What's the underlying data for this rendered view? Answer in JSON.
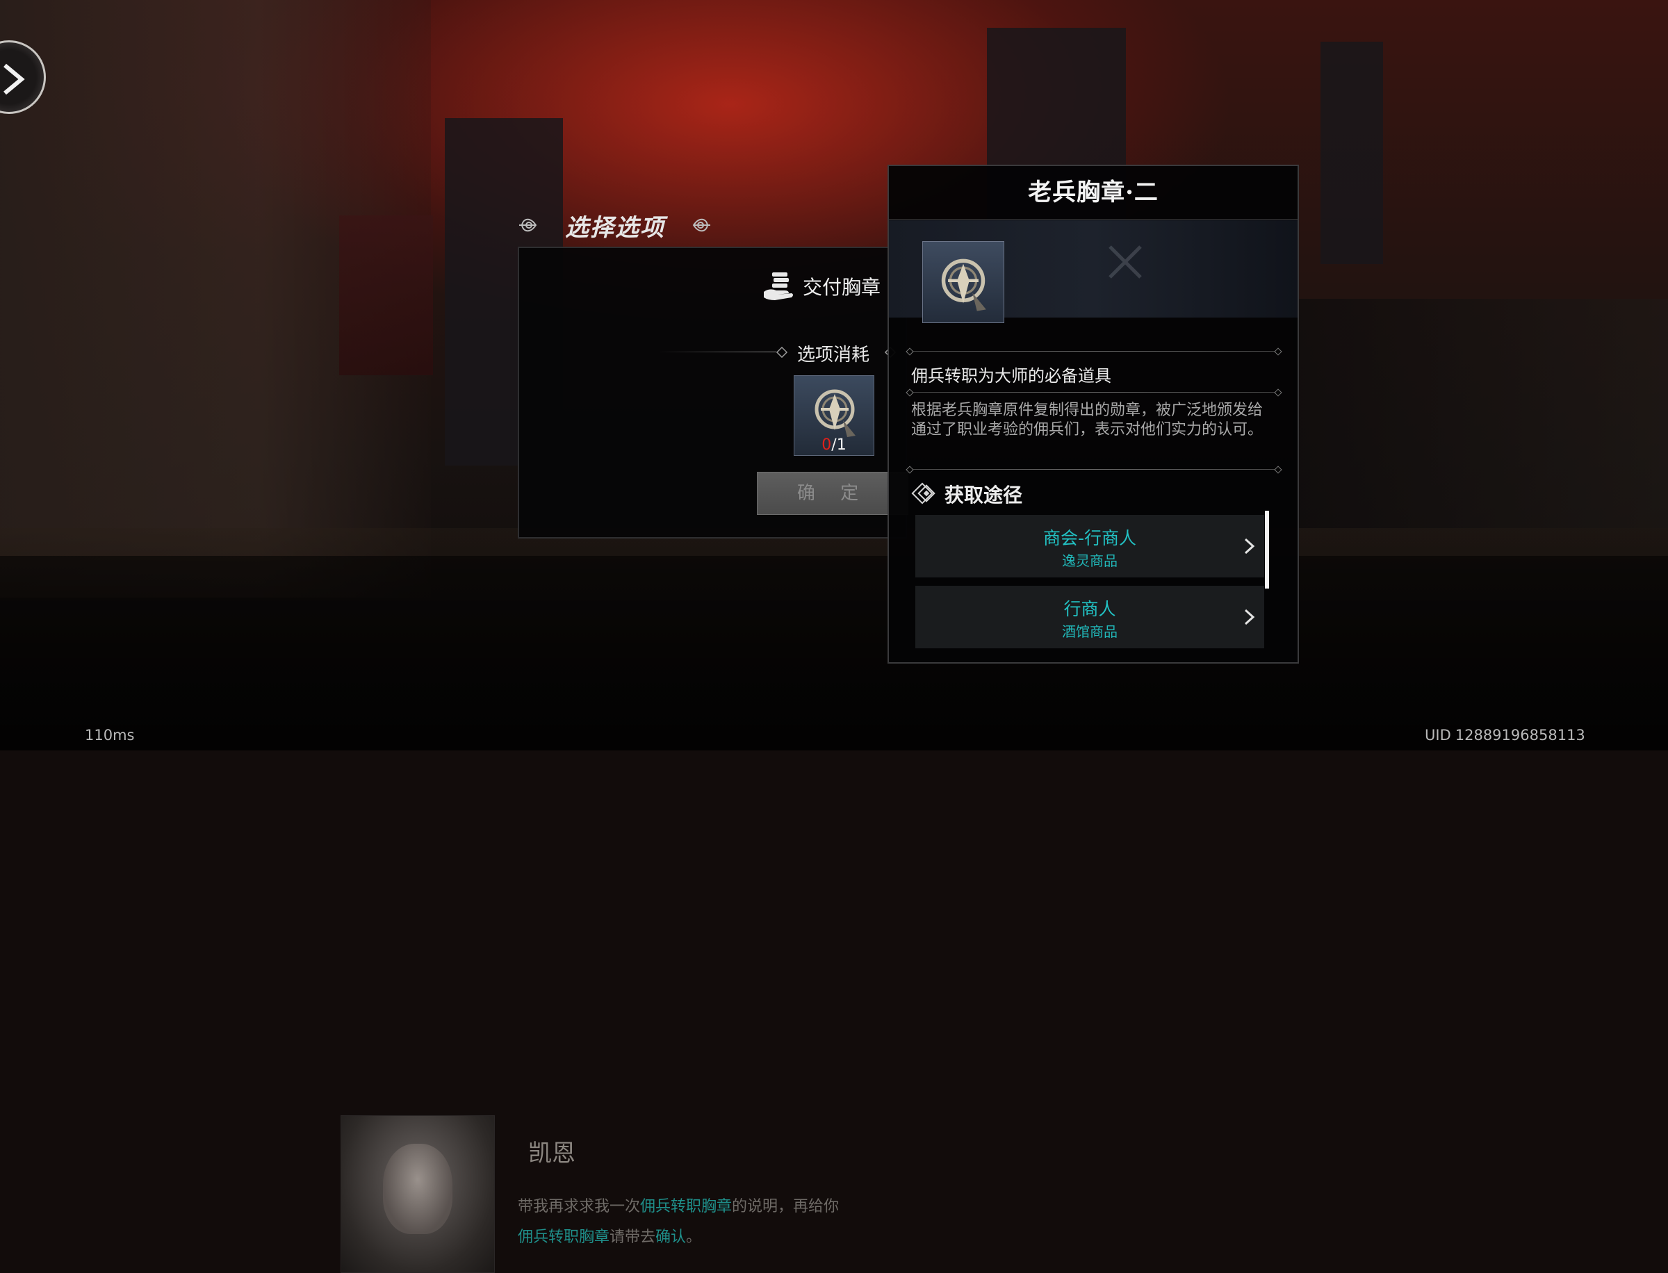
{
  "select_option": {
    "title": "选择选项",
    "deliver_label": "交付胸章",
    "cost_label": "选项消耗",
    "required_have": "0",
    "required_total": "/1",
    "confirm_label": "确 定"
  },
  "item_detail": {
    "title": "老兵胸章·二",
    "subtitle": "佣兵转职为大师的必备道具",
    "description": "根据老兵胸章原件复制得出的勋章，被广泛地颁发给通过了职业考验的佣兵们，表示对他们实力的认可。",
    "obtain_title": "获取途径",
    "sources": [
      {
        "name": "商会-行商人",
        "sub": "逸灵商品"
      },
      {
        "name": "行商人",
        "sub": "酒馆商品"
      }
    ]
  },
  "dialog": {
    "speaker": "凯恩",
    "line_1_a": "带我再求求我一次",
    "line_1_hl": "佣兵转职胸章",
    "line_1_b": "的说明，再给你",
    "line_2_hl": "佣兵转职胸章",
    "line_2_b": "请带去",
    "line_2_hl2": "确认",
    "line_2_c": "。"
  },
  "hud": {
    "ping": "110ms",
    "uid_label": "UID",
    "uid_value": "12889196858113"
  },
  "colors": {
    "source_text": "#22c2c4",
    "required_have": "#e0201a",
    "panel_bg": "#050506"
  },
  "icons": {
    "expand": "chevron-right-icon",
    "deliver": "coin-stack-icon",
    "badge": "veteran-badge-icon",
    "obtain": "diamond-icon"
  }
}
